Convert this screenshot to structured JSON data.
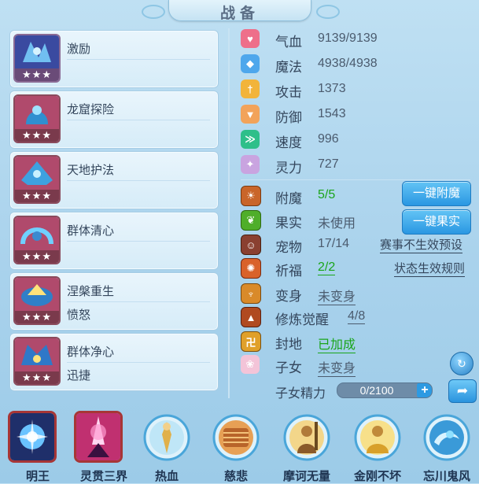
{
  "header": {
    "title": "战备"
  },
  "skills": [
    {
      "name": "激励",
      "sub": "",
      "stars": "★★★",
      "frame": "#6a4b78",
      "colors": [
        "#2d3a8a",
        "#7bd3ff"
      ]
    },
    {
      "name": "龙窟探险",
      "sub": "",
      "stars": "★★★",
      "frame": "#7a4050",
      "colors": [
        "#b5476a",
        "#4fb7e8"
      ]
    },
    {
      "name": "天地护法",
      "sub": "",
      "stars": "★★★",
      "frame": "#704860",
      "colors": [
        "#b5476a",
        "#86e0ff"
      ]
    },
    {
      "name": "群体清心",
      "sub": "",
      "stars": "★★★",
      "frame": "#704860",
      "colors": [
        "#b5476a",
        "#6fd0ff"
      ]
    },
    {
      "name": "涅槃重生",
      "sub": "愤怒",
      "stars": "★★★",
      "frame": "#704860",
      "colors": [
        "#b5476a",
        "#ffe27a"
      ]
    },
    {
      "name": "群体净心",
      "sub": "迅捷",
      "stars": "★★★",
      "frame": "#704860",
      "colors": [
        "#b5476a",
        "#5fb8ff"
      ]
    }
  ],
  "stats": [
    {
      "label": "气血",
      "value": "9139/9139",
      "icon": "heart-icon",
      "color": "#ee6f8a",
      "glyph": "♥"
    },
    {
      "label": "魔法",
      "value": "4938/4938",
      "icon": "mana-icon",
      "color": "#4ea7ec",
      "glyph": "◆"
    },
    {
      "label": "攻击",
      "value": "1373",
      "icon": "sword-icon",
      "color": "#f2b43a",
      "glyph": "†"
    },
    {
      "label": "防御",
      "value": "1543",
      "icon": "shield-icon",
      "color": "#f2a35a",
      "glyph": "▼"
    },
    {
      "label": "速度",
      "value": "996",
      "icon": "speed-icon",
      "color": "#2ebf8a",
      "glyph": "≫"
    },
    {
      "label": "灵力",
      "value": "727",
      "icon": "spirit-icon",
      "color": "#c9a4e0",
      "glyph": "✦"
    }
  ],
  "extras": {
    "fumo": {
      "label": "附魔",
      "value": "5/5"
    },
    "guoshi": {
      "label": "果实",
      "value": "未使用"
    },
    "chongwu": {
      "label": "宠物",
      "value": "17/14"
    },
    "qifu": {
      "label": "祈福",
      "value": "2/2"
    },
    "bianshen": {
      "label": "变身",
      "value": "未变身"
    },
    "xiulian": {
      "label": "修炼觉醒",
      "value": "4/8"
    },
    "fengdi": {
      "label": "封地",
      "value": "已加成"
    },
    "zinv": {
      "label": "子女",
      "value": "未变身"
    },
    "zinv_jingli": {
      "label": "子女精力",
      "value": "0/2100",
      "fill": 0
    }
  },
  "buttons": {
    "one_key_enchant": "一键附魔",
    "one_key_fruit": "一键果实"
  },
  "links": {
    "event_preset": "赛事不生效预设",
    "status_rules": "状态生效规则"
  },
  "tray": [
    {
      "label": "明王",
      "type": "square"
    },
    {
      "label": "灵贯三界",
      "type": "square"
    },
    {
      "label": "热血",
      "type": "round"
    },
    {
      "label": "慈悲",
      "type": "round"
    },
    {
      "label": "摩诃无量",
      "type": "round"
    },
    {
      "label": "金刚不坏",
      "type": "round"
    },
    {
      "label": "忘川鬼风",
      "type": "round"
    }
  ]
}
